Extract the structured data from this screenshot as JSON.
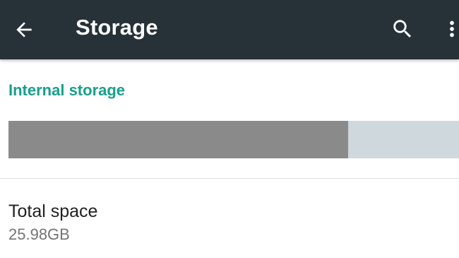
{
  "toolbar": {
    "title": "Storage",
    "back_icon": "arrow-back-icon",
    "search_icon": "search-icon",
    "overflow_icon": "more-vert-icon",
    "background_color": "#263238"
  },
  "internal_storage": {
    "header": "Internal storage",
    "header_color": "#16a08c",
    "used_fraction": 0.754,
    "used_color": "#8a8a8a",
    "free_color": "#cfd8dc"
  },
  "total_space": {
    "title": "Total space",
    "value": "25.98GB"
  }
}
